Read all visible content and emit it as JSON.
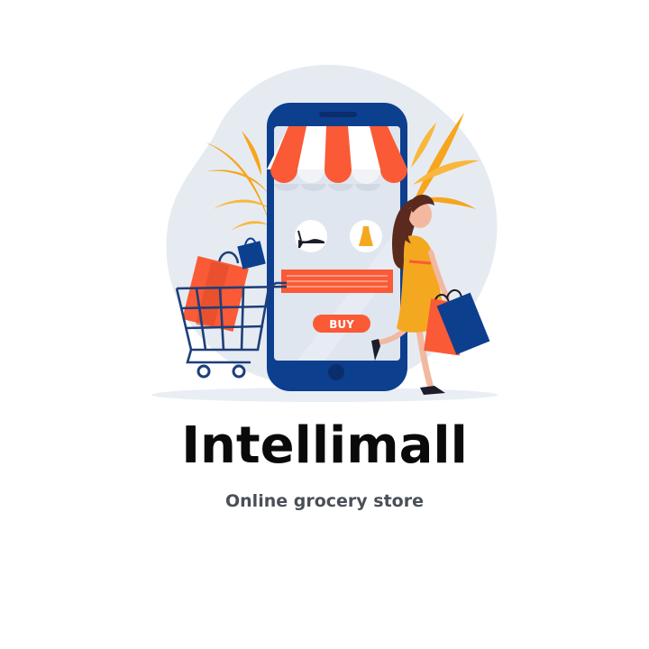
{
  "brand": {
    "name": "Intellimall",
    "tagline": "Online grocery store"
  },
  "illustration": {
    "buy_button_label": "BUY",
    "colors": {
      "phone": "#0d3f8f",
      "accent_orange": "#fa5a36",
      "leaf_yellow": "#f7a51c",
      "dress_yellow": "#f4a820",
      "background_blob": "#e6ebf2",
      "screen": "#dfe6f0"
    },
    "icons": [
      "shopping-cart-icon",
      "shopping-bag-icon",
      "high-heel-shoe-icon",
      "dress-icon",
      "awning-icon",
      "leaf-icon"
    ]
  }
}
